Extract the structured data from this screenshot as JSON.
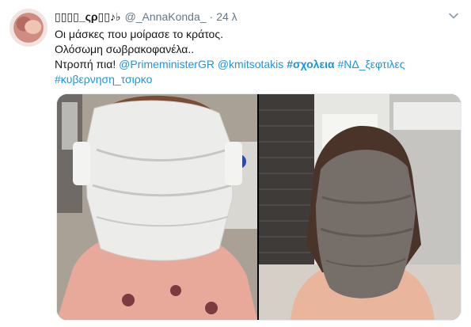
{
  "tweet": {
    "display_name": "▯▯▯▯_ςρ▯▯♪♭",
    "handle": "@_AnnaKonda_",
    "separator": "·",
    "time": "24 λ",
    "line1": "Οι μάσκες που μοίρασε το κράτος.",
    "line2": "Ολόσωμη σωβρακοφανέλα..",
    "line3_prefix": "Ντροπή πια!",
    "mention1": "@PrimeministerGR",
    "mention2": "@kmitsotakis",
    "hashtag1": "#σχολεια",
    "hashtag2": "#ΝΔ_ξεφτιλες",
    "hashtag3": "#κυβερνηση_τσιρκο"
  },
  "icons": {
    "menu": "chevron-down-icon",
    "avatar": "avatar"
  },
  "colors": {
    "link": "#1b95e0",
    "text": "#14171a",
    "muted": "#657786"
  }
}
